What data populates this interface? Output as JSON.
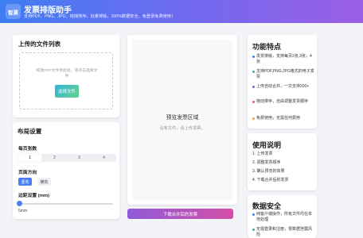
{
  "header": {
    "logo_text": "智票",
    "title": "发票排版助手",
    "subtitle": "支持PDF、PNG、JPG，拖拽排序，批量排版，100%数据安全，免登录免费使用！"
  },
  "upload": {
    "title": "上传的文件列表",
    "drop_hint": "拖放PDF文件到此处，或点击选择文件",
    "select_button": "选择文件"
  },
  "layout": {
    "title": "布局设置",
    "per_page_label": "每页张数",
    "per_page_options": [
      "1",
      "2",
      "3",
      "4"
    ],
    "per_page_selected": "1",
    "orientation_label": "页面方向",
    "orientation_options": [
      "竖向",
      "横向"
    ],
    "orientation_selected": "竖向",
    "margin_label": "边距设置 (mm)",
    "margin_value": "5mm",
    "margin_slider_fraction": 0.05
  },
  "preview": {
    "title": "预览发票区域",
    "empty_text": "没有文件，请上传发票。",
    "download_button": "下载合并后的发票"
  },
  "features": {
    "title": "功能特点",
    "items": [
      {
        "text": "发票排版，支持每页2张,3张，4张",
        "color": "#3a7cf2"
      },
      {
        "text": "支持PDF,PNG,JPG格式的电子发票",
        "color": "#2ab3a6"
      },
      {
        "text": "上传自动合并，一次支持200+",
        "color": "#8c5be0"
      },
      {
        "text": "拖动排序，自由调整发票顺序",
        "color": "#e54f8a"
      },
      {
        "text": "免费使用，无需任何费用",
        "color": "#f2a53a"
      }
    ]
  },
  "usage": {
    "title": "使用说明",
    "steps": [
      "1. 上传发票",
      "2. 调整发票顺序",
      "3. 确认预览的效果",
      "4. 下载合并后的发票"
    ]
  },
  "security": {
    "title": "数据安全",
    "items": [
      {
        "text": "纯客户端操作，所有文件均在本地处理",
        "color": "#3a7cf2"
      },
      {
        "text": "无需登录和注册，零数据泄露风险",
        "color": "#2ab3a6"
      }
    ]
  }
}
